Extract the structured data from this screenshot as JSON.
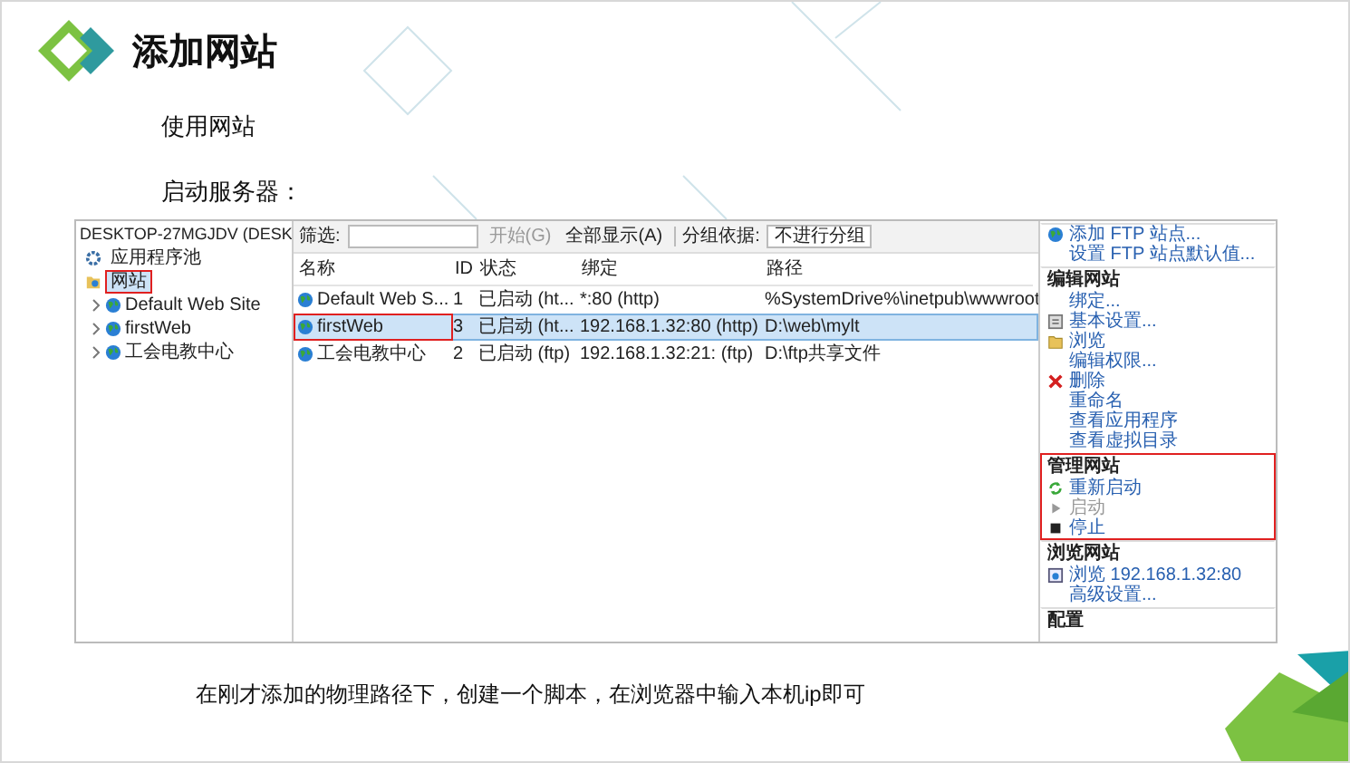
{
  "slide": {
    "title": "添加网站",
    "bullets": [
      "使用网站",
      "启动服务器："
    ],
    "caption": "在刚才添加的物理路径下，创建一个脚本，在浏览器中输入本机ip即可"
  },
  "iis": {
    "tree": {
      "label": "DESKTOP-27MGJDV (DESK",
      "children": [
        {
          "label": "应用程序池",
          "kind": "pool",
          "selected": false,
          "highlighted": false
        },
        {
          "label": "网站",
          "kind": "sites",
          "selected": true,
          "highlighted": true,
          "children": [
            {
              "label": "Default Web Site",
              "expanded": false
            },
            {
              "label": "firstWeb",
              "expanded": false
            },
            {
              "label": "工会电教中心",
              "expanded": false
            }
          ]
        }
      ]
    },
    "toolbar": {
      "filter_label": "筛选:",
      "start": "开始(G)",
      "show_all": "全部显示(A)",
      "group_by_label": "分组依据:",
      "group_by_value": "不进行分组"
    },
    "table": {
      "columns": [
        "名称",
        "ID",
        "状态",
        "绑定",
        "路径"
      ],
      "rows": [
        {
          "cells": [
            "Default Web S...",
            "1",
            "已启动 (ht...",
            "*:80 (http)",
            "%SystemDrive%\\inetpub\\wwwroot"
          ],
          "selected": false,
          "highlighted": false
        },
        {
          "cells": [
            "firstWeb",
            "3",
            "已启动 (ht...",
            "192.168.1.32:80 (http)",
            "D:\\web\\mylt"
          ],
          "selected": true,
          "highlighted": true
        },
        {
          "cells": [
            "工会电教中心",
            "2",
            "已启动 (ftp)",
            "192.168.1.32:21: (ftp)",
            "D:\\ftp共享文件"
          ],
          "selected": false,
          "highlighted": false
        }
      ]
    },
    "actions": [
      {
        "highlighted": false,
        "items": [
          {
            "label": "添加 FTP 站点...",
            "kind": "globe",
            "disabled": false
          },
          {
            "label": "设置 FTP 站点默认值...",
            "kind": "plain",
            "disabled": false
          }
        ]
      },
      {
        "title": "编辑网站",
        "highlighted": false,
        "items": [
          {
            "label": "绑定...",
            "kind": "plain",
            "disabled": false
          },
          {
            "label": "基本设置...",
            "kind": "settings",
            "disabled": false
          },
          {
            "label": "浏览",
            "kind": "folder",
            "disabled": false
          },
          {
            "label": "编辑权限...",
            "kind": "plain",
            "disabled": false
          },
          {
            "label": "删除",
            "kind": "delete",
            "disabled": false
          },
          {
            "label": "重命名",
            "kind": "plain",
            "disabled": false
          },
          {
            "label": "查看应用程序",
            "kind": "plain",
            "disabled": false
          },
          {
            "label": "查看虚拟目录",
            "kind": "plain",
            "disabled": false
          }
        ]
      },
      {
        "title": "管理网站",
        "highlighted": true,
        "items": [
          {
            "label": "重新启动",
            "kind": "restart",
            "disabled": false
          },
          {
            "label": "启动",
            "kind": "start",
            "disabled": true
          },
          {
            "label": "停止",
            "kind": "stop",
            "disabled": false
          }
        ]
      },
      {
        "title": "浏览网站",
        "highlighted": false,
        "items": [
          {
            "label": "浏览 192.168.1.32:80",
            "kind": "browser",
            "disabled": false
          },
          {
            "label": "高级设置...",
            "kind": "plain",
            "disabled": false
          }
        ]
      },
      {
        "title": "配置",
        "highlighted": false
      }
    ]
  }
}
